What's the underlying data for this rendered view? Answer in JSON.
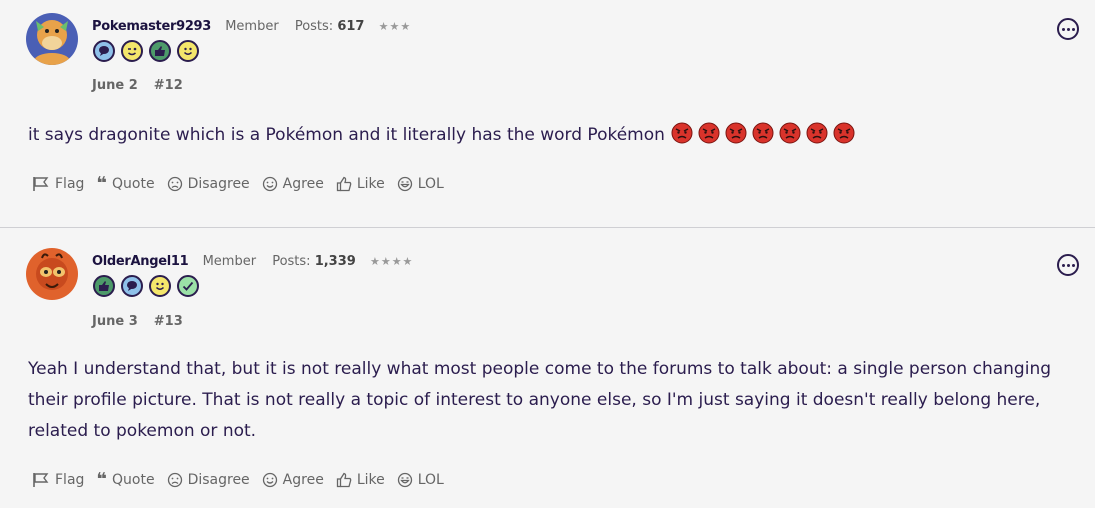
{
  "posts": [
    {
      "username": "Pokemaster9293",
      "rank": "Member",
      "posts_label": "Posts:",
      "posts_count": "617",
      "stars": "★★★",
      "badges": [
        "speech-bubble-badge",
        "wink-face-badge",
        "thumbs-up-badge",
        "smile-face-badge"
      ],
      "date": "June 2",
      "post_number": "#12",
      "body": "it says dragonite which is a Pokémon and it literally has the word Pokémon",
      "angry_emoji_count": 7,
      "avatar_colors": {
        "bg": "#4a5fb5",
        "main": "#e8a24a"
      }
    },
    {
      "username": "OlderAngel11",
      "rank": "Member",
      "posts_label": "Posts:",
      "posts_count": "1,339",
      "stars": "★★★★",
      "badges": [
        "thumbs-up-badge",
        "speech-bubble-badge",
        "smile-face-badge",
        "check-badge"
      ],
      "date": "June 3",
      "post_number": "#13",
      "body": "Yeah I understand that, but it is not really what most people come to the forums to talk about: a single person changing their profile picture. That is not really a topic of interest to anyone else, so I'm just saying it doesn't really belong here, related to pokemon or not.",
      "avatar_colors": {
        "bg": "#e0622c",
        "main": "#f2c36b"
      }
    }
  ],
  "reactions": {
    "flag": "Flag",
    "quote": "Quote",
    "disagree": "Disagree",
    "agree": "Agree",
    "like": "Like",
    "lol": "LOL"
  },
  "colors": {
    "text": "#2b1d4e",
    "muted": "#666666",
    "angry": "#d9332b",
    "badge_blue": "#8fc1ea",
    "badge_yellow": "#f4e66b",
    "badge_green": "#4d9a6a",
    "badge_check": "#9be0a7"
  }
}
